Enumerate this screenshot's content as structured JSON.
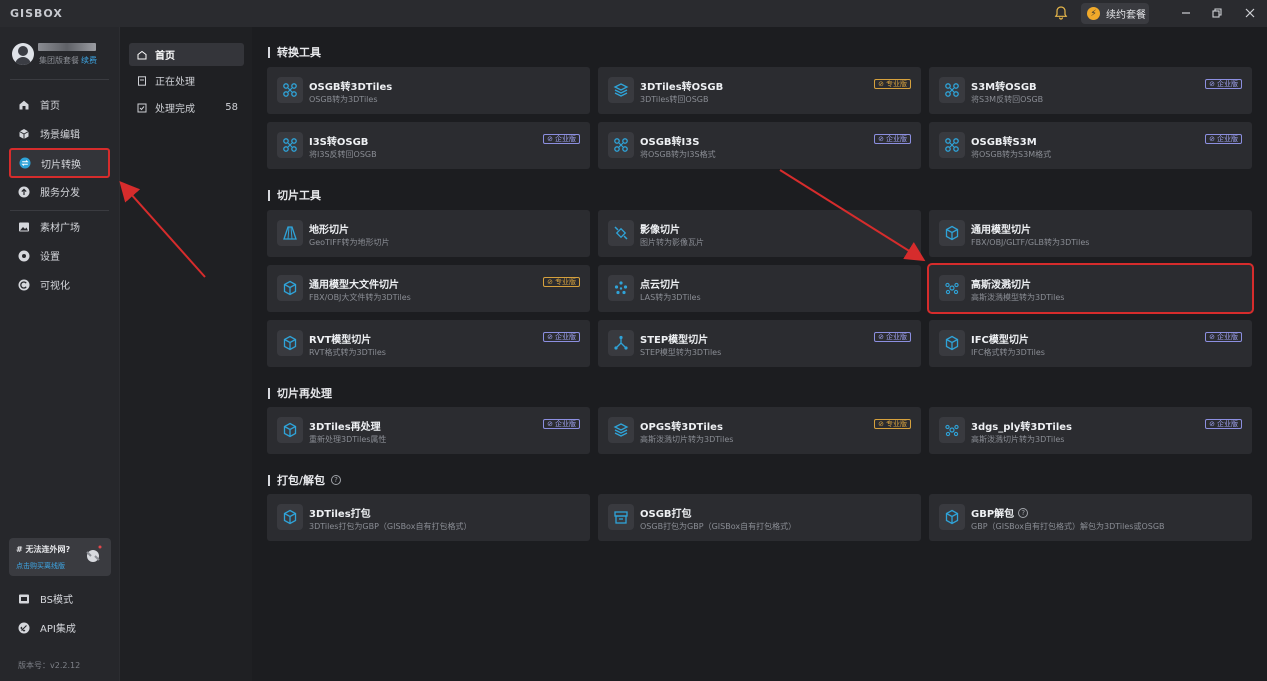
{
  "app": {
    "logo": "GISBOX",
    "renew_label": "续约套餐"
  },
  "user": {
    "plan": "集团版套餐",
    "renew": "续费"
  },
  "sidebar": {
    "items": [
      {
        "label": "首页",
        "icon": "home-icon"
      },
      {
        "label": "场景编辑",
        "icon": "scene-icon"
      },
      {
        "label": "切片转换",
        "icon": "convert-icon"
      },
      {
        "label": "服务分发",
        "icon": "upload-icon"
      },
      {
        "label": "素材广场",
        "icon": "image-icon"
      },
      {
        "label": "设置",
        "icon": "gear-icon"
      },
      {
        "label": "可视化",
        "icon": "visual-icon"
      }
    ],
    "promo": {
      "question": "# 无法连外网?",
      "link": "点击购买离线版"
    },
    "bottom": [
      {
        "label": "BS模式",
        "icon": "bs-icon"
      },
      {
        "label": "API集成",
        "icon": "api-icon"
      }
    ],
    "version": "版本号：v2.2.12"
  },
  "panel2": {
    "items": [
      {
        "label": "首页"
      },
      {
        "label": "正在处理"
      },
      {
        "label": "处理完成",
        "count": "58"
      }
    ]
  },
  "sections": [
    {
      "title": "转换工具",
      "cards": [
        {
          "title": "OSGB转3DTiles",
          "desc": "OSGB转为3DTiles",
          "badge": ""
        },
        {
          "title": "3DTiles转OSGB",
          "desc": "3DTiles转回OSGB",
          "badge": "专业版"
        },
        {
          "title": "S3M转OSGB",
          "desc": "将S3M反转回OSGB",
          "badge": "企业版"
        },
        {
          "title": "I3S转OSGB",
          "desc": "将I3S反转回OSGB",
          "badge": "企业版"
        },
        {
          "title": "OSGB转I3S",
          "desc": "将OSGB转为I3S格式",
          "badge": "企业版"
        },
        {
          "title": "OSGB转S3M",
          "desc": "将OSGB转为S3M格式",
          "badge": "企业版"
        }
      ]
    },
    {
      "title": "切片工具",
      "cards": [
        {
          "title": "地形切片",
          "desc": "GeoTIFF转为地形切片",
          "badge": ""
        },
        {
          "title": "影像切片",
          "desc": "图片转为影像瓦片",
          "badge": ""
        },
        {
          "title": "通用模型切片",
          "desc": "FBX/OBJ/GLTF/GLB转为3DTiles",
          "badge": ""
        },
        {
          "title": "通用模型大文件切片",
          "desc": "FBX/OBJ大文件转为3DTiles",
          "badge": "专业版"
        },
        {
          "title": "点云切片",
          "desc": "LAS转为3DTiles",
          "badge": ""
        },
        {
          "title": "高斯泼溅切片",
          "desc": "高斯泼溅模型转为3DTiles",
          "badge": ""
        },
        {
          "title": "RVT模型切片",
          "desc": "RVT格式转为3DTiles",
          "badge": "企业版"
        },
        {
          "title": "STEP模型切片",
          "desc": "STEP模型转为3DTiles",
          "badge": "企业版"
        },
        {
          "title": "IFC模型切片",
          "desc": "IFC格式转为3DTiles",
          "badge": "企业版"
        }
      ]
    },
    {
      "title": "切片再处理",
      "cards": [
        {
          "title": "3DTiles再处理",
          "desc": "重新处理3DTiles属性",
          "badge": "企业版"
        },
        {
          "title": "OPGS转3DTiles",
          "desc": "高斯泼溅切片转为3DTiles",
          "badge": "专业版"
        },
        {
          "title": "3dgs_ply转3DTiles",
          "desc": "高斯泼溅切片转为3DTiles",
          "badge": "企业版"
        }
      ]
    },
    {
      "title": "打包/解包",
      "cards": [
        {
          "title": "3DTiles打包",
          "desc": "3DTiles打包为GBP（GISBox自有打包格式）",
          "badge": ""
        },
        {
          "title": "OSGB打包",
          "desc": "OSGB打包为GBP（GISBox自有打包格式）",
          "badge": ""
        },
        {
          "title": "GBP解包",
          "desc": "GBP（GISBox自有打包格式）解包为3DTiles或OSGB",
          "badge": ""
        }
      ]
    }
  ],
  "colors": {
    "accent": "#2fa3d8",
    "highlight": "#d62c2c",
    "pro": "#d6a13d",
    "enterprise": "#9da0ee"
  }
}
